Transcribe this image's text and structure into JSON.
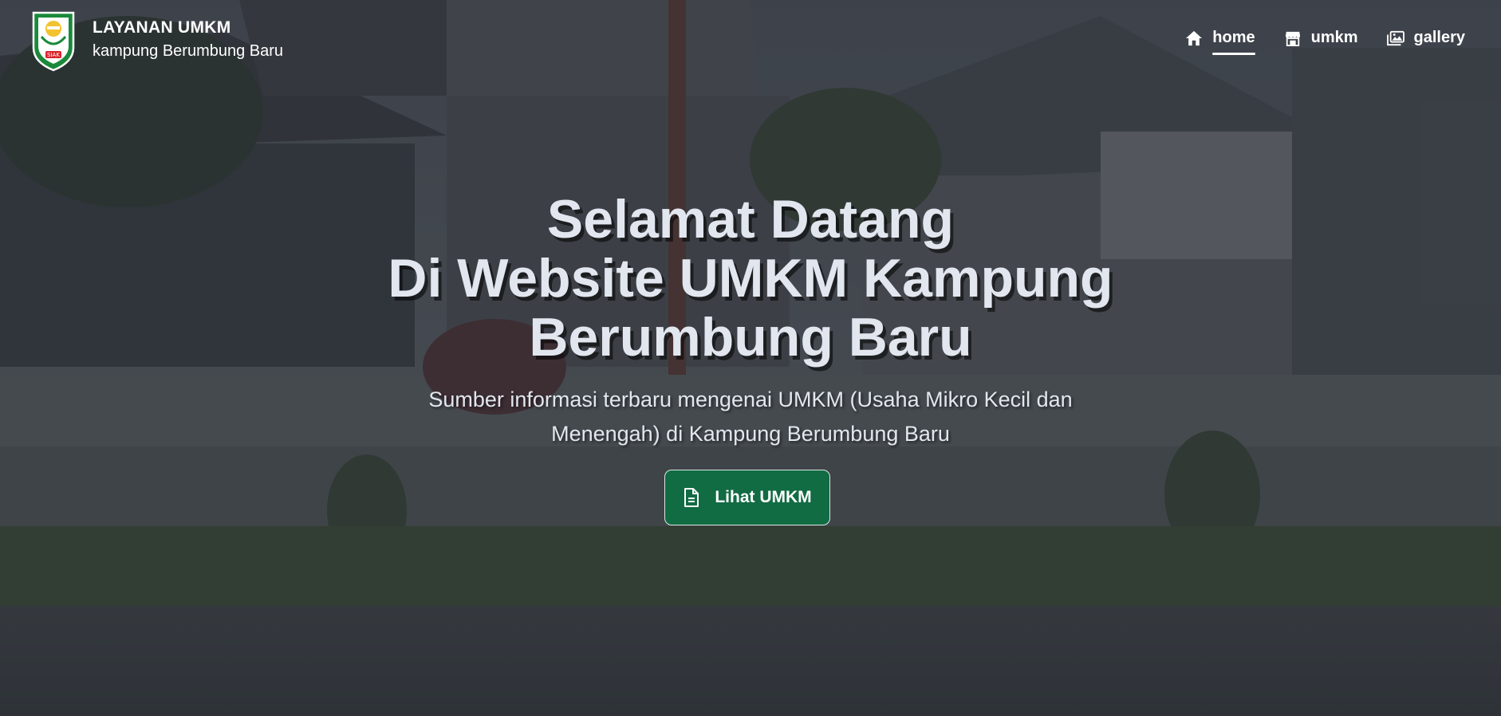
{
  "brand": {
    "title": "LAYANAN UMKM",
    "subtitle": "kampung Berumbung Baru",
    "logo_icon": "siak-regency-emblem",
    "logo_text": "SIAK"
  },
  "nav": {
    "items": [
      {
        "label": "home",
        "icon": "house-icon",
        "active": true
      },
      {
        "label": "umkm",
        "icon": "store-icon",
        "active": false
      },
      {
        "label": "gallery",
        "icon": "images-icon",
        "active": false
      }
    ]
  },
  "hero": {
    "background": "photo of village office building (Kampung Berumbung Baru) with dark overlay",
    "headline_lines": [
      "Selamat Datang",
      "Di Website UMKM Kampung",
      "Berumbung Baru"
    ],
    "subtitle": "Sumber informasi terbaru mengenai UMKM (Usaha Mikro Kecil dan Menengah) di Kampung Berumbung Baru",
    "cta": {
      "label": "Lihat UMKM",
      "icon": "document-icon"
    }
  },
  "colors": {
    "overlay": "#1e222a",
    "headline": "#e2e6ee",
    "cta_bg": "#116b43",
    "nav_text": "#ffffff"
  }
}
